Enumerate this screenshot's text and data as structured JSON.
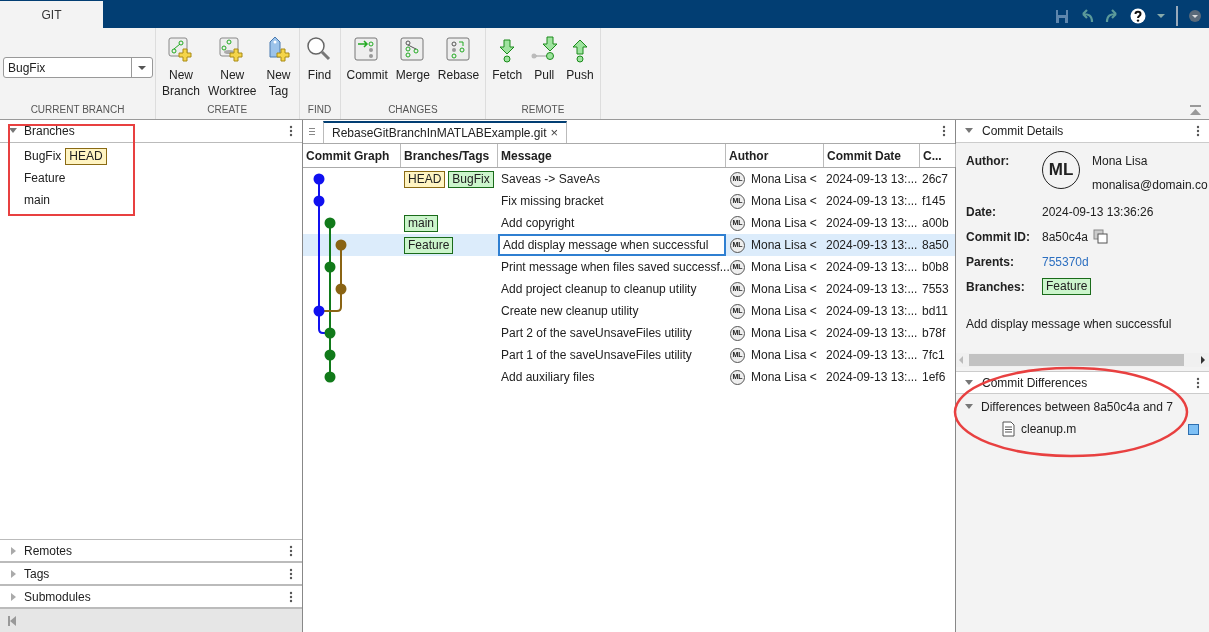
{
  "ribbon_tabs": [
    {
      "label": "GIT",
      "selected": true
    }
  ],
  "toolstrip": {
    "current_branch": {
      "value": "BugFix",
      "label": "CURRENT BRANCH"
    },
    "groups": [
      {
        "label": "CREATE",
        "buttons": [
          {
            "label": "New\nBranch",
            "kind": "new-branch"
          },
          {
            "label": "New\nWorktree",
            "kind": "new-worktree"
          },
          {
            "label": "New\nTag",
            "kind": "new-tag"
          }
        ]
      },
      {
        "label": "FIND",
        "buttons": [
          {
            "label": "Find",
            "kind": "find"
          }
        ]
      },
      {
        "label": "CHANGES",
        "buttons": [
          {
            "label": "Commit",
            "kind": "commit"
          },
          {
            "label": "Merge",
            "kind": "merge"
          },
          {
            "label": "Rebase",
            "kind": "rebase"
          }
        ]
      },
      {
        "label": "REMOTE",
        "buttons": [
          {
            "label": "Fetch",
            "kind": "fetch"
          },
          {
            "label": "Pull",
            "kind": "pull"
          },
          {
            "label": "Push",
            "kind": "push"
          }
        ]
      }
    ]
  },
  "left_panel": {
    "sections": [
      {
        "title": "Branches",
        "expanded": true,
        "items": [
          {
            "name": "BugFix",
            "refs": [
              {
                "label": "HEAD",
                "kind": "head"
              }
            ]
          },
          {
            "name": "Feature"
          },
          {
            "name": "main"
          }
        ]
      },
      {
        "title": "Remotes",
        "expanded": false
      },
      {
        "title": "Tags",
        "expanded": false
      },
      {
        "title": "Submodules",
        "expanded": false
      }
    ]
  },
  "document_tab": {
    "title": "RebaseGitBranchInMATLABExample.git",
    "close": "×"
  },
  "table": {
    "columns": [
      "Commit Graph",
      "Branches/Tags",
      "Message",
      "Author",
      "Commit Date",
      "C..."
    ],
    "rows": [
      {
        "color": "#1010f0",
        "refs": [
          {
            "label": "HEAD",
            "kind": "head"
          },
          {
            "label": "BugFix",
            "kind": "branch"
          }
        ],
        "message": "Saveas -> SaveAs",
        "avatar": "ML",
        "author": "Mona Lisa <",
        "date": "2024-09-13 13:...",
        "hash": "26c7",
        "selected": false
      },
      {
        "color": "#1010f0",
        "refs": [],
        "message": "Fix missing bracket",
        "avatar": "ML",
        "author": "Mona Lisa <",
        "date": "2024-09-13 13:...",
        "hash": "f145",
        "selected": false
      },
      {
        "color": "#117a1a",
        "refs": [
          {
            "label": "main",
            "kind": "branch"
          }
        ],
        "message": "Add copyright",
        "avatar": "ML",
        "author": "Mona Lisa <",
        "date": "2024-09-13 13:...",
        "hash": "a00b",
        "selected": false
      },
      {
        "color": "#8a6414",
        "refs": [
          {
            "label": "Feature",
            "kind": "branch"
          }
        ],
        "message": "Add display message when successful",
        "avatar": "ML",
        "author": "Mona Lisa <",
        "date": "2024-09-13 13:...",
        "hash": "8a50",
        "selected": true
      },
      {
        "color": "#117a1a",
        "refs": [],
        "message": "Print message when files saved successf...",
        "avatar": "ML",
        "author": "Mona Lisa <",
        "date": "2024-09-13 13:...",
        "hash": "b0b8",
        "selected": false
      },
      {
        "color": "#8a6414",
        "refs": [],
        "message": "Add project cleanup to cleanup utility",
        "avatar": "ML",
        "author": "Mona Lisa <",
        "date": "2024-09-13 13:...",
        "hash": "7553",
        "selected": false
      },
      {
        "color": "#1010f0",
        "refs": [],
        "message": "Create new cleanup utility",
        "avatar": "ML",
        "author": "Mona Lisa <",
        "date": "2024-09-13 13:...",
        "hash": "bd11",
        "selected": false
      },
      {
        "color": "#117a1a",
        "refs": [],
        "message": "Part 2 of the saveUnsaveFiles utility",
        "avatar": "ML",
        "author": "Mona Lisa <",
        "date": "2024-09-13 13:...",
        "hash": "b78f",
        "selected": false
      },
      {
        "color": "#117a1a",
        "refs": [],
        "message": "Part 1 of the saveUnsaveFiles utility",
        "avatar": "ML",
        "author": "Mona Lisa <",
        "date": "2024-09-13 13:...",
        "hash": "7fc1",
        "selected": false
      },
      {
        "color": "#117a1a",
        "refs": [],
        "message": "Add auxiliary files",
        "avatar": "ML",
        "author": "Mona Lisa <",
        "date": "2024-09-13 13:...",
        "hash": "1ef6",
        "selected": false
      }
    ]
  },
  "commit_details": {
    "title": "Commit Details",
    "expanded": true,
    "avatar": "ML",
    "fields": [
      {
        "label": "Author:",
        "kind": "author",
        "name": "Mona Lisa",
        "email": "monalisa@domain.co"
      },
      {
        "label": "Date:",
        "kind": "text",
        "value": "2024-09-13 13:36:26"
      },
      {
        "label": "Commit ID:",
        "kind": "copy",
        "value": "8a50c4a"
      },
      {
        "label": "Parents:",
        "kind": "link",
        "value": "755370d"
      },
      {
        "label": "Branches:",
        "kind": "branch",
        "value": "Feature"
      }
    ],
    "message": "Add display message when successful"
  },
  "commit_differences": {
    "title": "Commit Differences",
    "expanded": true,
    "tree": [
      {
        "label": "Differences between 8a50c4a and 7",
        "expanded": true,
        "children": [
          {
            "label": "cleanup.m"
          }
        ]
      }
    ]
  }
}
